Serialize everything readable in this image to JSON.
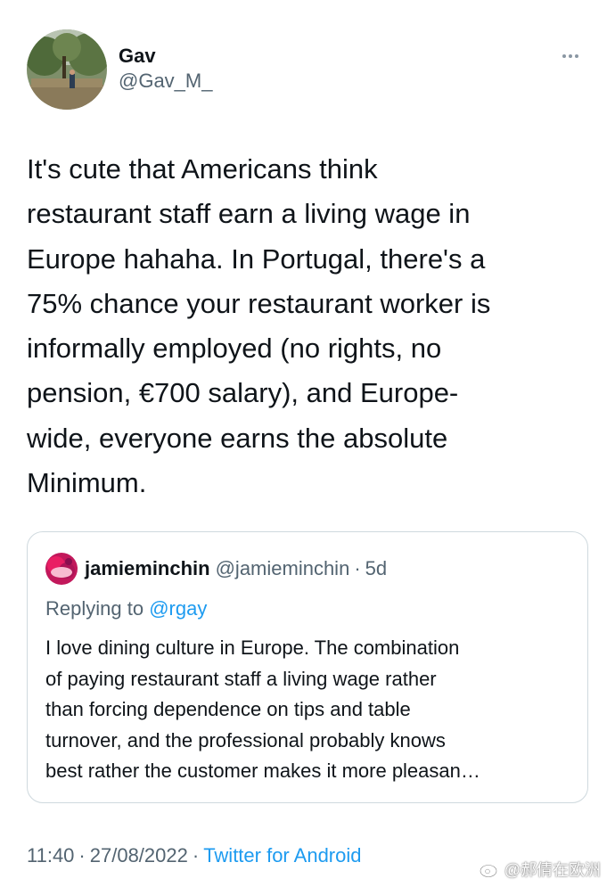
{
  "tweet": {
    "author": {
      "display_name": "Gav",
      "handle": "@Gav_M_"
    },
    "text": "It's cute that Americans think\nrestaurant staff earn a living wage in\nEurope hahaha. In Portugal, there's a\n75% chance your restaurant worker is\ninformally employed (no rights, no\npension, €700 salary), and Europe-\nwide, everyone earns the absolute\nMinimum.",
    "quoted": {
      "display_name": "jamieminchin",
      "handle": "@jamieminchin",
      "separator": "·",
      "age": "5d",
      "replying_prefix": "Replying to",
      "replying_to": "@rgay",
      "text": "I love dining culture in Europe. The combination\nof paying restaurant staff a living wage rather\nthan forcing dependence on tips and table\nturnover, and the professional probably knows\nbest rather the customer makes it more pleasan…"
    },
    "meta": {
      "time": "11:40",
      "separator": "·",
      "date": "27/08/2022",
      "source": "Twitter for Android"
    }
  },
  "watermark": {
    "text": "@郝倩在欧洲"
  },
  "colors": {
    "text": "#0f1419",
    "secondary": "#536471",
    "link": "#1d9bf0",
    "border": "#cfd9de"
  },
  "icons": {
    "more": "more-horizontal-icon",
    "watermark": "weibo-logo-icon"
  }
}
